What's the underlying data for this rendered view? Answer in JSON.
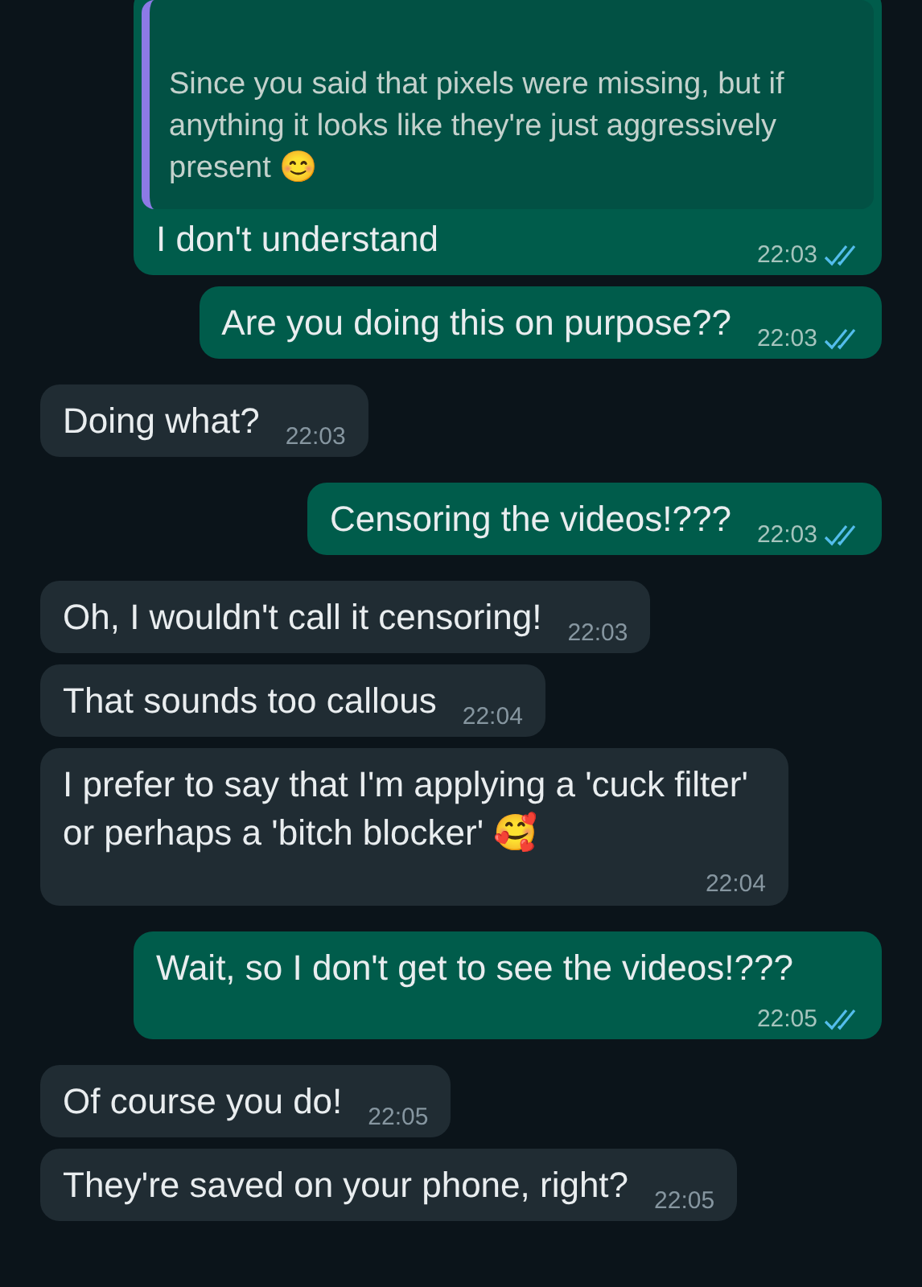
{
  "messages": [
    {
      "kind": "outgoing",
      "quote": {
        "text": "Since you said that pixels were missing, but if anything it looks like they're just aggressively present 😊"
      },
      "text": "I don't understand",
      "time": "22:03",
      "read": true
    },
    {
      "kind": "outgoing",
      "text": "Are you doing this on purpose??",
      "time": "22:03",
      "read": true
    },
    {
      "kind": "incoming",
      "text": "Doing what?",
      "time": "22:03"
    },
    {
      "kind": "outgoing",
      "text": "Censoring the videos!???",
      "time": "22:03",
      "read": true
    },
    {
      "kind": "incoming",
      "text": "Oh, I wouldn't call it censoring!",
      "time": "22:03"
    },
    {
      "kind": "incoming",
      "text": "That sounds too callous",
      "time": "22:04"
    },
    {
      "kind": "incoming",
      "text": "I prefer to say that I'm applying a 'cuck filter' or perhaps a 'bitch blocker' 🥰",
      "time": "22:04"
    },
    {
      "kind": "outgoing",
      "text": "Wait, so I don't get to see the videos!???",
      "time": "22:05",
      "read": true
    },
    {
      "kind": "incoming",
      "text": "Of course you do!",
      "time": "22:05"
    },
    {
      "kind": "incoming",
      "text": "They're saved on your phone, right?",
      "time": "22:05"
    }
  ]
}
